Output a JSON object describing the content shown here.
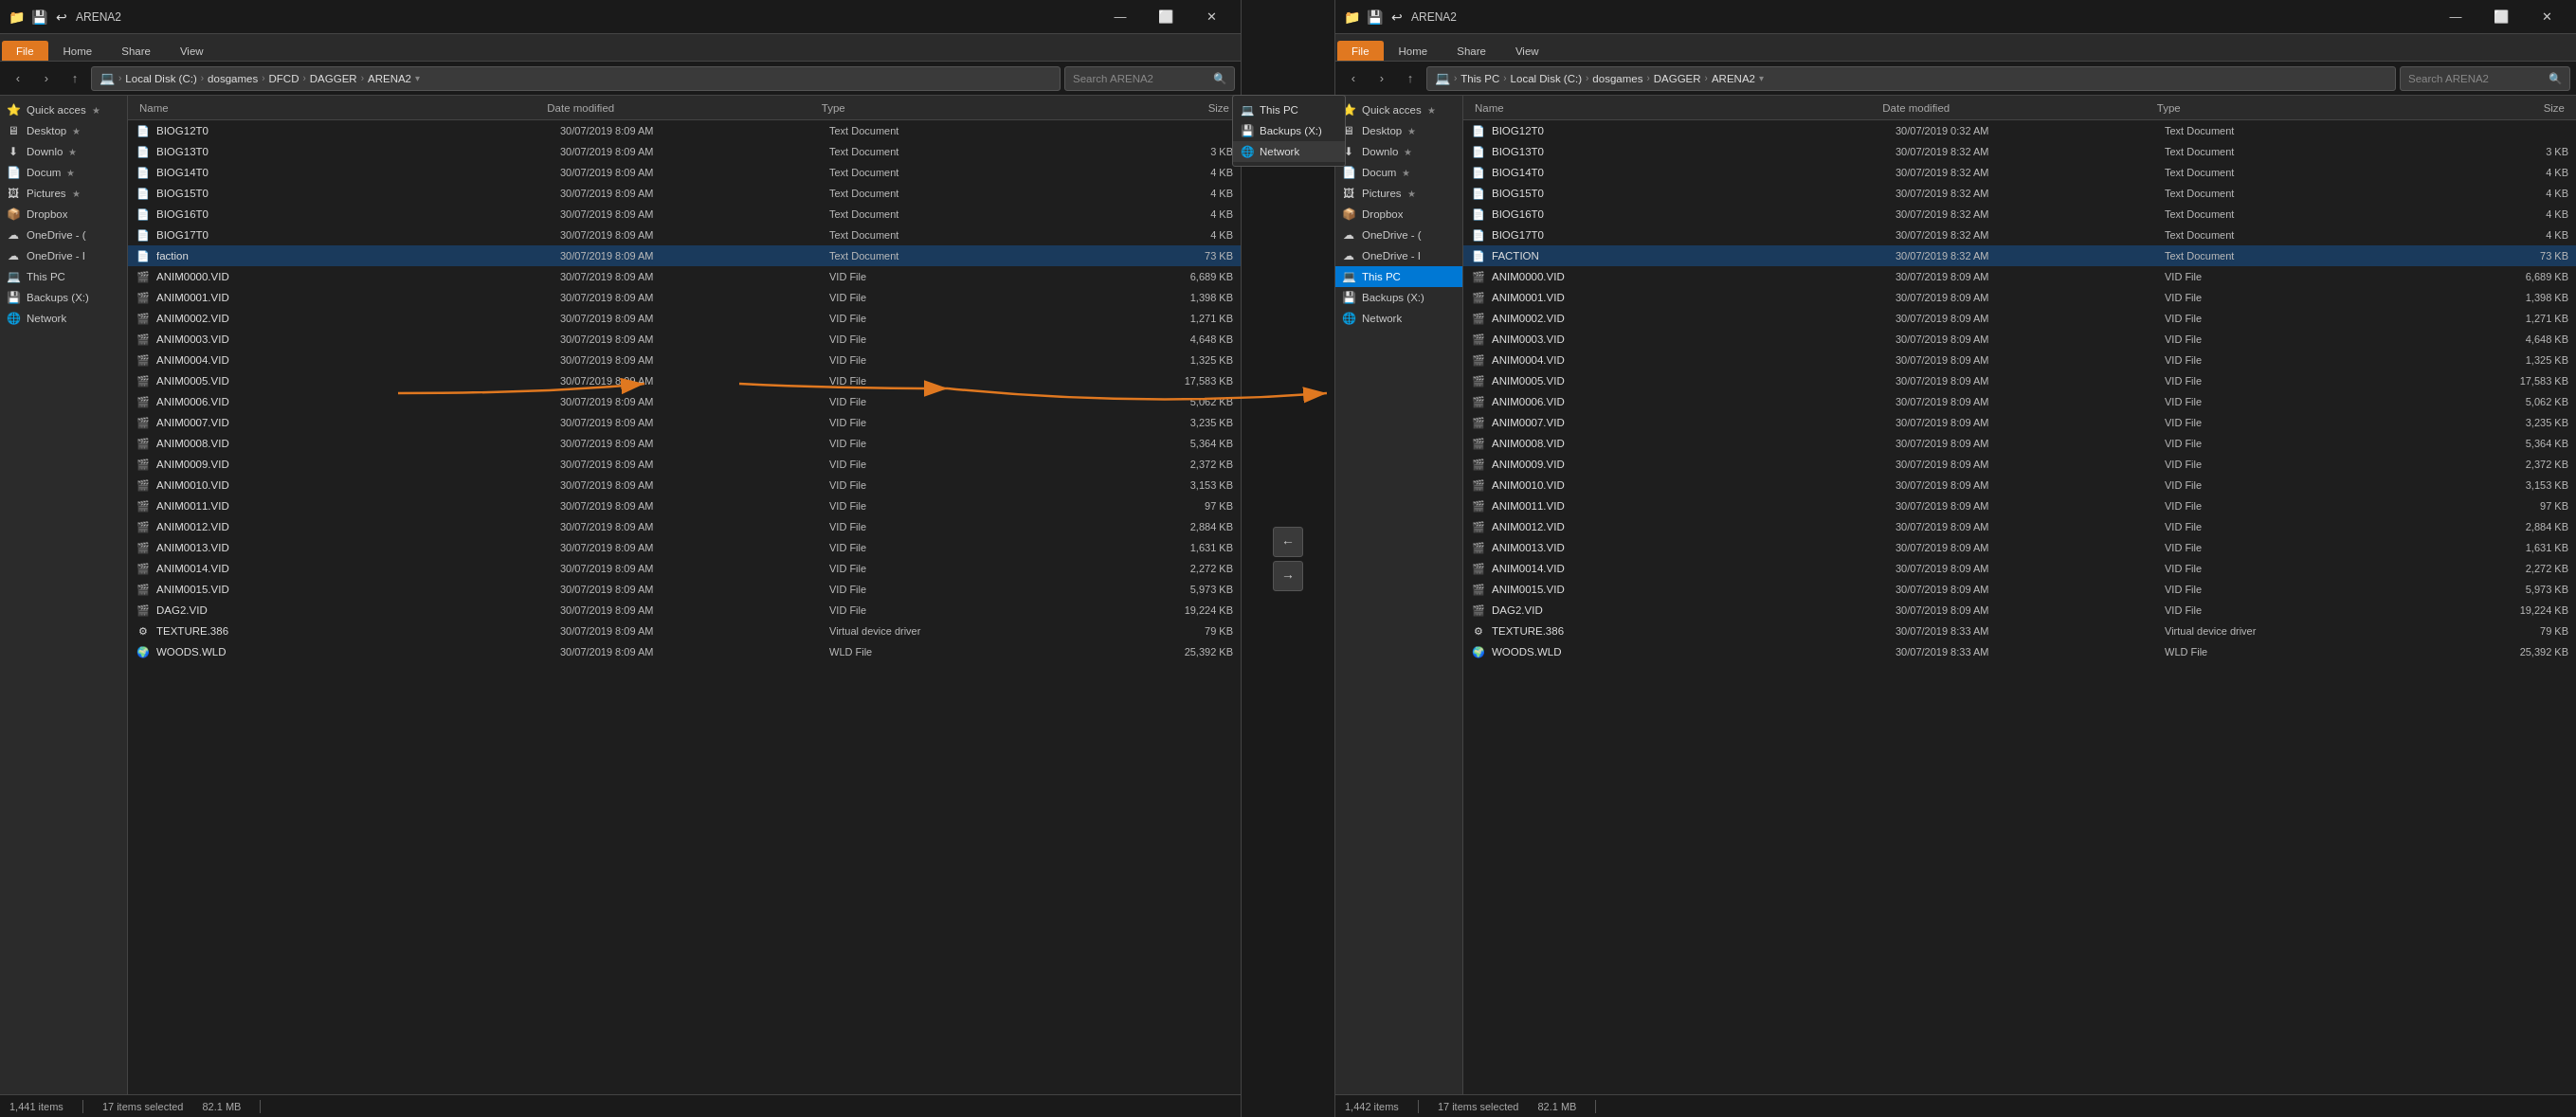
{
  "leftWindow": {
    "titleBar": {
      "icons": [
        "📁",
        "💾",
        "↩"
      ],
      "title": "ARENA2",
      "controls": [
        "—",
        "⬜",
        "✕"
      ]
    },
    "ribbon": {
      "tabs": [
        "File",
        "Home",
        "Share",
        "View"
      ],
      "activeTab": "File"
    },
    "addressBar": {
      "path": "Local Disk (C:) › dosgames › DFCD › DAGGER › ARENA2",
      "pathParts": [
        "Local Disk (C:)",
        "dosgames",
        "DFCD",
        "DAGGER",
        "ARENA2"
      ],
      "searchPlaceholder": "Search ARENA2"
    },
    "sidebar": {
      "items": [
        {
          "label": "Quick acces",
          "icon": "⭐",
          "pinned": true
        },
        {
          "label": "Desktop",
          "icon": "🖥",
          "pinned": true
        },
        {
          "label": "Downlo",
          "icon": "⬇",
          "pinned": true
        },
        {
          "label": "Docum",
          "icon": "📄",
          "pinned": true
        },
        {
          "label": "Pictures",
          "icon": "🖼",
          "pinned": true
        },
        {
          "label": "Dropbox",
          "icon": "📦"
        },
        {
          "label": "OneDrive - (",
          "icon": "☁"
        },
        {
          "label": "OneDrive - I",
          "icon": "☁"
        },
        {
          "label": "This PC",
          "icon": "💻"
        },
        {
          "label": "Backups (X:)",
          "icon": "💾"
        },
        {
          "label": "Network",
          "icon": "🌐"
        }
      ]
    },
    "columns": [
      "Name",
      "Date modified",
      "Type",
      "Size"
    ],
    "files": [
      {
        "name": "BIOG12T0",
        "date": "30/07/2019 8:09 AM",
        "type": "Text Document",
        "size": ""
      },
      {
        "name": "BIOG13T0",
        "date": "30/07/2019 8:09 AM",
        "type": "Text Document",
        "size": "3 KB"
      },
      {
        "name": "BIOG14T0",
        "date": "30/07/2019 8:09 AM",
        "type": "Text Document",
        "size": "4 KB"
      },
      {
        "name": "BIOG15T0",
        "date": "30/07/2019 8:09 AM",
        "type": "Text Document",
        "size": "4 KB"
      },
      {
        "name": "BIOG16T0",
        "date": "30/07/2019 8:09 AM",
        "type": "Text Document",
        "size": "4 KB"
      },
      {
        "name": "BIOG17T0",
        "date": "30/07/2019 8:09 AM",
        "type": "Text Document",
        "size": "4 KB"
      },
      {
        "name": "faction",
        "date": "30/07/2019 8:09 AM",
        "type": "Text Document",
        "size": "73 KB",
        "highlighted": true
      },
      {
        "name": "ANIM0000.VID",
        "date": "30/07/2019 8:09 AM",
        "type": "VID File",
        "size": "6,689 KB"
      },
      {
        "name": "ANIM0001.VID",
        "date": "30/07/2019 8:09 AM",
        "type": "VID File",
        "size": "1,398 KB"
      },
      {
        "name": "ANIM0002.VID",
        "date": "30/07/2019 8:09 AM",
        "type": "VID File",
        "size": "1,271 KB"
      },
      {
        "name": "ANIM0003.VID",
        "date": "30/07/2019 8:09 AM",
        "type": "VID File",
        "size": "4,648 KB"
      },
      {
        "name": "ANIM0004.VID",
        "date": "30/07/2019 8:09 AM",
        "type": "VID File",
        "size": "1,325 KB"
      },
      {
        "name": "ANIM0005.VID",
        "date": "30/07/2019 8:09 AM",
        "type": "VID File",
        "size": "17,583 KB"
      },
      {
        "name": "ANIM0006.VID",
        "date": "30/07/2019 8:09 AM",
        "type": "VID File",
        "size": "5,062 KB"
      },
      {
        "name": "ANIM0007.VID",
        "date": "30/07/2019 8:09 AM",
        "type": "VID File",
        "size": "3,235 KB"
      },
      {
        "name": "ANIM0008.VID",
        "date": "30/07/2019 8:09 AM",
        "type": "VID File",
        "size": "5,364 KB"
      },
      {
        "name": "ANIM0009.VID",
        "date": "30/07/2019 8:09 AM",
        "type": "VID File",
        "size": "2,372 KB"
      },
      {
        "name": "ANIM0010.VID",
        "date": "30/07/2019 8:09 AM",
        "type": "VID File",
        "size": "3,153 KB"
      },
      {
        "name": "ANIM0011.VID",
        "date": "30/07/2019 8:09 AM",
        "type": "VID File",
        "size": "97 KB"
      },
      {
        "name": "ANIM0012.VID",
        "date": "30/07/2019 8:09 AM",
        "type": "VID File",
        "size": "2,884 KB"
      },
      {
        "name": "ANIM0013.VID",
        "date": "30/07/2019 8:09 AM",
        "type": "VID File",
        "size": "1,631 KB"
      },
      {
        "name": "ANIM0014.VID",
        "date": "30/07/2019 8:09 AM",
        "type": "VID File",
        "size": "2,272 KB"
      },
      {
        "name": "ANIM0015.VID",
        "date": "30/07/2019 8:09 AM",
        "type": "VID File",
        "size": "5,973 KB"
      },
      {
        "name": "DAG2.VID",
        "date": "30/07/2019 8:09 AM",
        "type": "VID File",
        "size": "19,224 KB"
      },
      {
        "name": "TEXTURE.386",
        "date": "30/07/2019 8:09 AM",
        "type": "Virtual device driver",
        "size": "79 KB"
      },
      {
        "name": "WOODS.WLD",
        "date": "30/07/2019 8:09 AM",
        "type": "WLD File",
        "size": "25,392 KB"
      }
    ],
    "statusBar": {
      "itemCount": "1,441 items",
      "selectedCount": "17 items selected",
      "selectedSize": "82.1 MB"
    }
  },
  "rightWindow": {
    "titleBar": {
      "icons": [
        "📁",
        "💾",
        "↩"
      ],
      "title": "ARENA2",
      "controls": [
        "—",
        "⬜",
        "✕"
      ]
    },
    "ribbon": {
      "tabs": [
        "File",
        "Home",
        "Share",
        "View"
      ],
      "activeTab": "File"
    },
    "addressBar": {
      "path": "This PC › Local Disk (C:) › dosgames › DAGGER › ARENA2",
      "pathParts": [
        "This PC",
        "Local Disk (C:)",
        "dosgames",
        "DAGGER",
        "ARENA2"
      ],
      "searchPlaceholder": "Search ARENA2"
    },
    "sidebar": {
      "items": [
        {
          "label": "Quick acces",
          "icon": "⭐",
          "pinned": true
        },
        {
          "label": "Desktop",
          "icon": "🖥",
          "pinned": true
        },
        {
          "label": "Downlo",
          "icon": "⬇",
          "pinned": true
        },
        {
          "label": "Docum",
          "icon": "📄",
          "pinned": true
        },
        {
          "label": "Pictures",
          "icon": "🖼",
          "pinned": true
        },
        {
          "label": "Dropbox",
          "icon": "📦"
        },
        {
          "label": "OneDrive - (",
          "icon": "☁"
        },
        {
          "label": "OneDrive - I",
          "icon": "☁"
        },
        {
          "label": "This PC",
          "icon": "💻",
          "selected": true
        },
        {
          "label": "Backups (X:)",
          "icon": "💾"
        },
        {
          "label": "Network",
          "icon": "🌐"
        }
      ]
    },
    "columns": [
      "Name",
      "Date modified",
      "Type",
      "Size"
    ],
    "files": [
      {
        "name": "BIOG12T0",
        "date": "30/07/2019 0:32 AM",
        "type": "Text Document",
        "size": ""
      },
      {
        "name": "BIOG13T0",
        "date": "30/07/2019 8:32 AM",
        "type": "Text Document",
        "size": "3 KB"
      },
      {
        "name": "BIOG14T0",
        "date": "30/07/2019 8:32 AM",
        "type": "Text Document",
        "size": "4 KB"
      },
      {
        "name": "BIOG15T0",
        "date": "30/07/2019 8:32 AM",
        "type": "Text Document",
        "size": "4 KB"
      },
      {
        "name": "BIOG16T0",
        "date": "30/07/2019 8:32 AM",
        "type": "Text Document",
        "size": "4 KB"
      },
      {
        "name": "BIOG17T0",
        "date": "30/07/2019 8:32 AM",
        "type": "Text Document",
        "size": "4 KB"
      },
      {
        "name": "FACTION",
        "date": "30/07/2019 8:32 AM",
        "type": "Text Document",
        "size": "73 KB",
        "highlighted": true
      },
      {
        "name": "ANIM0000.VID",
        "date": "30/07/2019 8:09 AM",
        "type": "VID File",
        "size": "6,689 KB"
      },
      {
        "name": "ANIM0001.VID",
        "date": "30/07/2019 8:09 AM",
        "type": "VID File",
        "size": "1,398 KB"
      },
      {
        "name": "ANIM0002.VID",
        "date": "30/07/2019 8:09 AM",
        "type": "VID File",
        "size": "1,271 KB"
      },
      {
        "name": "ANIM0003.VID",
        "date": "30/07/2019 8:09 AM",
        "type": "VID File",
        "size": "4,648 KB"
      },
      {
        "name": "ANIM0004.VID",
        "date": "30/07/2019 8:09 AM",
        "type": "VID File",
        "size": "1,325 KB"
      },
      {
        "name": "ANIM0005.VID",
        "date": "30/07/2019 8:09 AM",
        "type": "VID File",
        "size": "17,583 KB"
      },
      {
        "name": "ANIM0006.VID",
        "date": "30/07/2019 8:09 AM",
        "type": "VID File",
        "size": "5,062 KB"
      },
      {
        "name": "ANIM0007.VID",
        "date": "30/07/2019 8:09 AM",
        "type": "VID File",
        "size": "3,235 KB"
      },
      {
        "name": "ANIM0008.VID",
        "date": "30/07/2019 8:09 AM",
        "type": "VID File",
        "size": "5,364 KB"
      },
      {
        "name": "ANIM0009.VID",
        "date": "30/07/2019 8:09 AM",
        "type": "VID File",
        "size": "2,372 KB"
      },
      {
        "name": "ANIM0010.VID",
        "date": "30/07/2019 8:09 AM",
        "type": "VID File",
        "size": "3,153 KB"
      },
      {
        "name": "ANIM0011.VID",
        "date": "30/07/2019 8:09 AM",
        "type": "VID File",
        "size": "97 KB"
      },
      {
        "name": "ANIM0012.VID",
        "date": "30/07/2019 8:09 AM",
        "type": "VID File",
        "size": "2,884 KB"
      },
      {
        "name": "ANIM0013.VID",
        "date": "30/07/2019 8:09 AM",
        "type": "VID File",
        "size": "1,631 KB"
      },
      {
        "name": "ANIM0014.VID",
        "date": "30/07/2019 8:09 AM",
        "type": "VID File",
        "size": "2,272 KB"
      },
      {
        "name": "ANIM0015.VID",
        "date": "30/07/2019 8:09 AM",
        "type": "VID File",
        "size": "5,973 KB"
      },
      {
        "name": "DAG2.VID",
        "date": "30/07/2019 8:09 AM",
        "type": "VID File",
        "size": "19,224 KB"
      },
      {
        "name": "TEXTURE.386",
        "date": "30/07/2019 8:33 AM",
        "type": "Virtual device driver",
        "size": "79 KB"
      },
      {
        "name": "WOODS.WLD",
        "date": "30/07/2019 8:33 AM",
        "type": "WLD File",
        "size": "25,392 KB"
      }
    ],
    "statusBar": {
      "itemCount": "1,442 items",
      "selectedCount": "17 items selected",
      "selectedSize": "82.1 MB"
    }
  },
  "midNav": {
    "leftBtn": "←",
    "rightBtn": "→"
  },
  "annotations": {
    "arrowColor": "#e07820",
    "labels": {
      "faction_left": "faction",
      "network_left": "Network",
      "network_right": "Network"
    }
  }
}
